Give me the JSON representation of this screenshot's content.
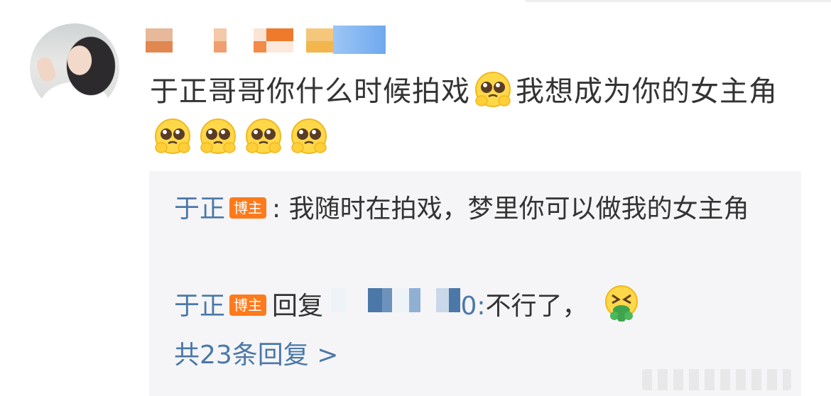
{
  "comment": {
    "text_part1": "于正哥哥你什么时候拍戏",
    "text_part2": "我想成为你的女主角",
    "emoji_name": "pleading-face-emoji"
  },
  "replies": [
    {
      "author": "于正",
      "badge": "博主",
      "separator": ":",
      "text": "我随时在拍戏，梦里你可以做我的女主角"
    },
    {
      "author": "于正",
      "badge": "博主",
      "action": "回复",
      "target_suffix": "0:",
      "text": "不行了，",
      "emoji_name": "vomiting-face-emoji"
    }
  ],
  "more_replies": "共23条回复 >",
  "colors": {
    "link_blue": "#4b78a8",
    "badge_orange": "#ff7a1b",
    "reply_bg": "#f5f5f7",
    "text": "#333333"
  }
}
